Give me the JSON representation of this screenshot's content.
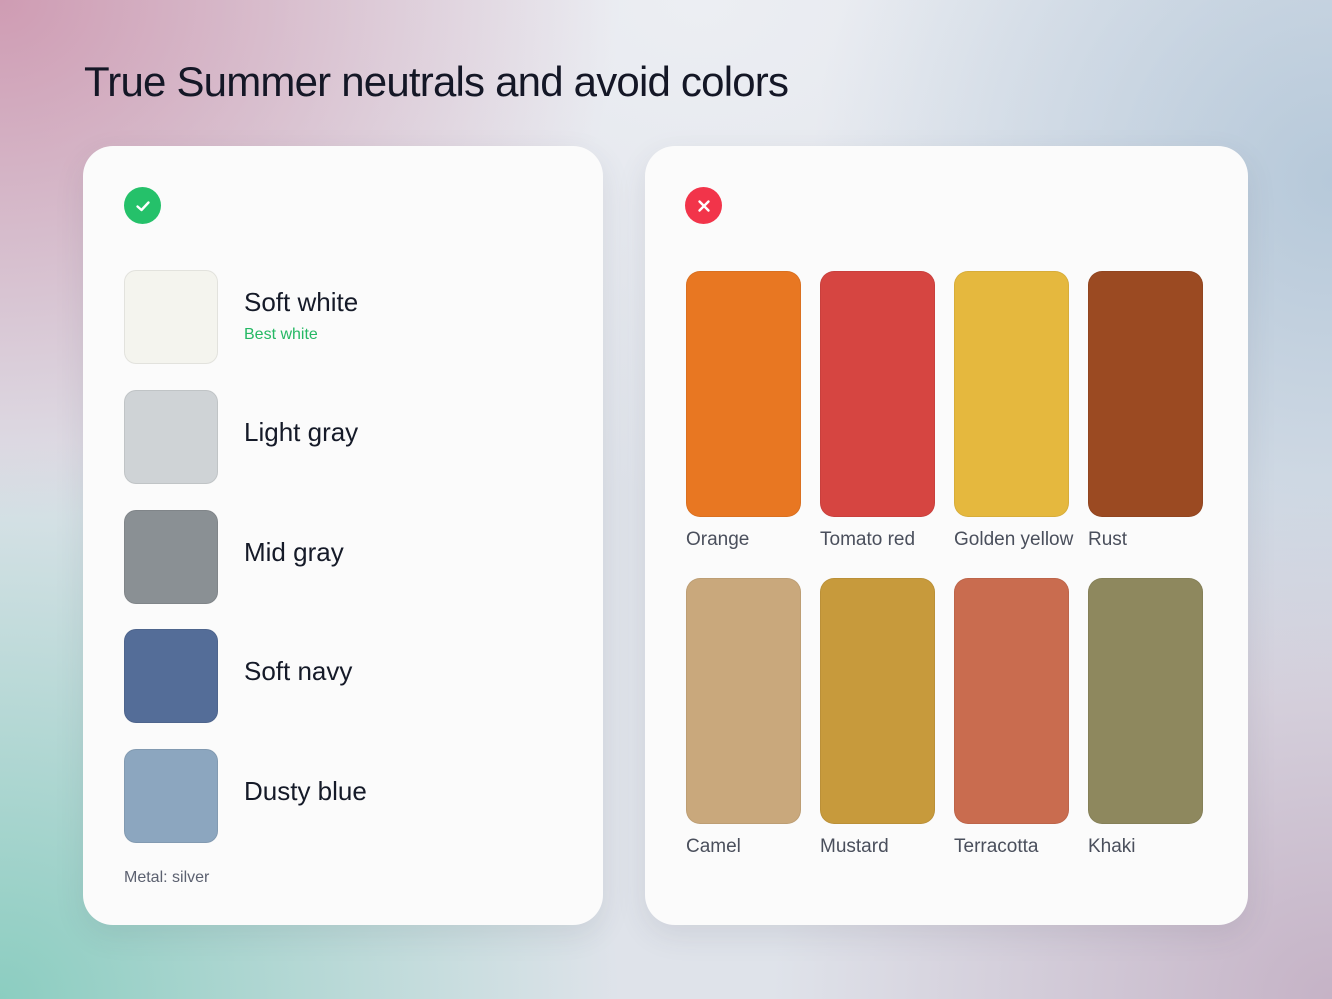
{
  "page": {
    "title": "True Summer neutrals and avoid colors"
  },
  "neutrals": {
    "badge_icon": "check-icon",
    "badge_color": "#25c16a",
    "items": [
      {
        "name": "Soft white",
        "note": "Best white",
        "color": "#f4f4ee"
      },
      {
        "name": "Light gray",
        "note": "",
        "color": "#cfd3d6"
      },
      {
        "name": "Mid gray",
        "note": "",
        "color": "#8a9094"
      },
      {
        "name": "Soft navy",
        "note": "",
        "color": "#546d98"
      },
      {
        "name": "Dusty blue",
        "note": "",
        "color": "#8ca6bf"
      }
    ],
    "metal_note": "Metal: silver"
  },
  "avoid": {
    "badge_icon": "close-icon",
    "badge_color": "#f2344a",
    "items": [
      {
        "name": "Orange",
        "color": "#e87722"
      },
      {
        "name": "Tomato red",
        "color": "#d64541"
      },
      {
        "name": "Golden yellow",
        "color": "#e5b83e"
      },
      {
        "name": "Rust",
        "color": "#9b4a22"
      },
      {
        "name": "Camel",
        "color": "#c9a87c"
      },
      {
        "name": "Mustard",
        "color": "#c79a3c"
      },
      {
        "name": "Terracotta",
        "color": "#c96c4f"
      },
      {
        "name": "Khaki",
        "color": "#8e885e"
      }
    ]
  }
}
